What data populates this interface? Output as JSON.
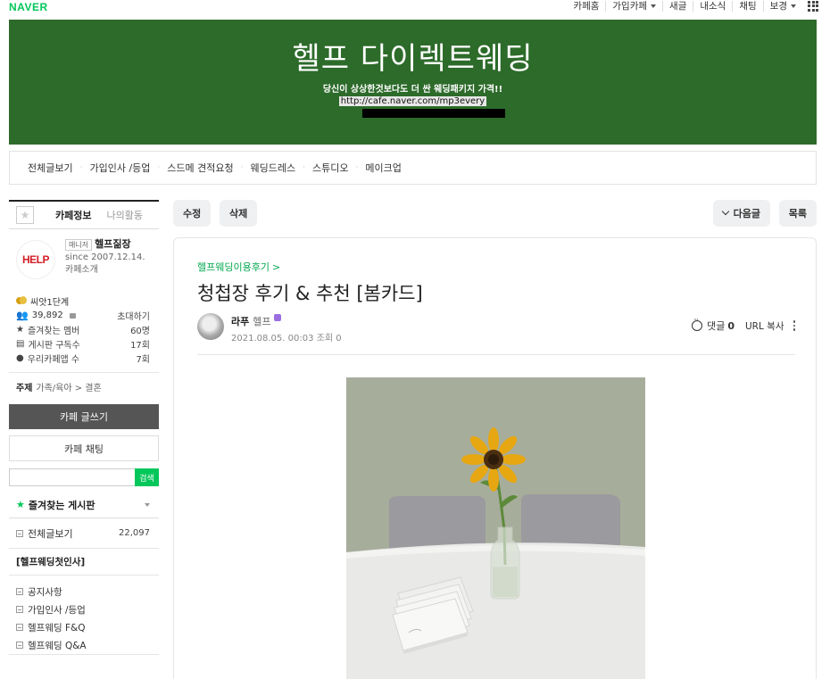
{
  "topbar": {
    "logo": "NAVER",
    "links": [
      "카페홈",
      "가입카페",
      "새글",
      "내소식",
      "채팅",
      "보경"
    ]
  },
  "banner": {
    "title": "헬프 다이렉트웨딩",
    "subtitle": "당신이 상상한것보다도 더 싼 웨딩패키지 가격!!",
    "url": "http://cafe.naver.com/mp3every"
  },
  "menu": [
    "전체글보기",
    "가입인사 /등업",
    "스드메 견적요청",
    "웨딩드레스",
    "스튜디오",
    "메이크업"
  ],
  "sidebar": {
    "tab_info": "카페정보",
    "tab_activity": "나의활동",
    "manager_badge": "매니저",
    "manager_name": "헬프짊장",
    "since": "since 2007.12.14.",
    "intro": "카페소개",
    "logo_text": "HELP",
    "level": "씨앗1단계",
    "members": "39,892",
    "invite": "초대하기",
    "stat_fav_label": "즐겨찾는 멤버",
    "stat_fav_value": "60명",
    "stat_board_label": "게시판 구독수",
    "stat_board_value": "17회",
    "stat_app_label": "우리카페앱 수",
    "stat_app_value": "7회",
    "subject_label": "주제",
    "subject_value": "가족/육아 > 결혼",
    "write_btn": "카페 글쓰기",
    "chat_btn": "카페 채팅",
    "search_btn": "검색",
    "fav_boards": "즐겨찾는 게시판",
    "all_posts": "전체글보기",
    "all_posts_count": "22,097",
    "group_title": "[헬프웨딩첫인사]",
    "boards": [
      "공지사항",
      "가입인사 /등업",
      "헬프웨딩 F&Q",
      "헬프웨딩 Q&A"
    ]
  },
  "toolbar": {
    "edit": "수정",
    "delete": "삭제",
    "next": "다음글",
    "list": "목록"
  },
  "article": {
    "category": "헬프웨딩이용후기",
    "title": "청첩장 후기 & 추천 [봄카드]",
    "author": "라푸",
    "author_level": "헬프",
    "date": "2021.08.05. 00:03",
    "views_label": "조회 0",
    "comments_label": "댓글",
    "comments_count": "0",
    "url_copy": "URL 복사"
  },
  "colors": {
    "banner_green": "#2d6b2a",
    "naver_green": "#03c75a"
  }
}
